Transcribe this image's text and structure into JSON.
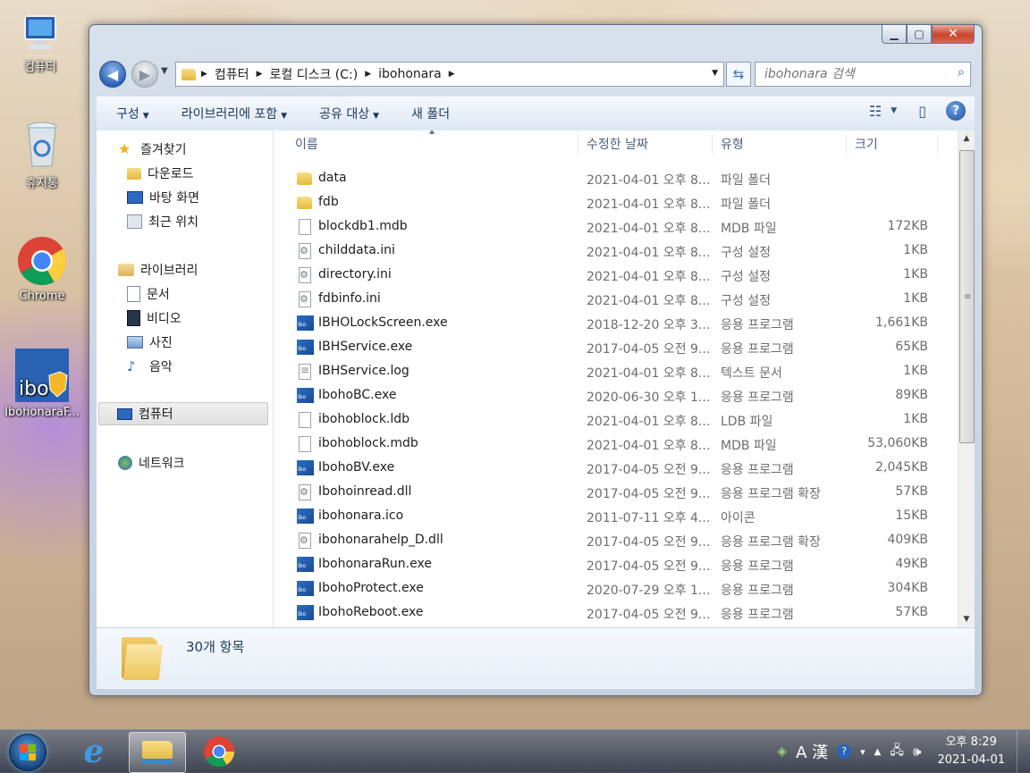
{
  "desktop": {
    "icons": [
      {
        "label": "컴퓨터"
      },
      {
        "label": "휴지통"
      },
      {
        "label": "Chrome"
      },
      {
        "label": "IbohonaraF..."
      }
    ]
  },
  "window": {
    "address": {
      "segments": [
        "컴퓨터",
        "로컬 디스크 (C:)",
        "ibohonara"
      ]
    },
    "search": {
      "placeholder": "ibohonara 검색"
    },
    "commands": [
      "구성",
      "라이브러리에 포함",
      "공유 대상",
      "새 폴더"
    ],
    "nav": {
      "favorites": "즐겨찾기",
      "downloads": "다운로드",
      "desktop": "바탕 화면",
      "recent": "최근 위치",
      "libraries": "라이브러리",
      "documents": "문서",
      "videos": "비디오",
      "pictures": "사진",
      "music": "음악",
      "computer": "컴퓨터",
      "network": "네트워크"
    },
    "columns": {
      "name": "이름",
      "date": "수정한 날짜",
      "type": "유형",
      "size": "크기"
    },
    "files": [
      {
        "name": "data",
        "date": "2021-04-01 오후 8...",
        "type": "파일 폴더",
        "size": "",
        "icon": "folder"
      },
      {
        "name": "fdb",
        "date": "2021-04-01 오후 8...",
        "type": "파일 폴더",
        "size": "",
        "icon": "folder"
      },
      {
        "name": "blockdb1.mdb",
        "date": "2021-04-01 오후 8...",
        "type": "MDB 파일",
        "size": "172KB",
        "icon": "file"
      },
      {
        "name": "childdata.ini",
        "date": "2021-04-01 오후 8...",
        "type": "구성 설정",
        "size": "1KB",
        "icon": "gear"
      },
      {
        "name": "directory.ini",
        "date": "2021-04-01 오후 8...",
        "type": "구성 설정",
        "size": "1KB",
        "icon": "gear"
      },
      {
        "name": "fdbinfo.ini",
        "date": "2021-04-01 오후 8...",
        "type": "구성 설정",
        "size": "1KB",
        "icon": "gear"
      },
      {
        "name": "IBHOLockScreen.exe",
        "date": "2018-12-20 오후 3...",
        "type": "응용 프로그램",
        "size": "1,661KB",
        "icon": "ibo"
      },
      {
        "name": "IBHService.exe",
        "date": "2017-04-05 오전 9...",
        "type": "응용 프로그램",
        "size": "65KB",
        "icon": "ibo"
      },
      {
        "name": "IBHService.log",
        "date": "2021-04-01 오후 8...",
        "type": "텍스트 문서",
        "size": "1KB",
        "icon": "txt"
      },
      {
        "name": "IbohoBC.exe",
        "date": "2020-06-30 오후 1...",
        "type": "응용 프로그램",
        "size": "89KB",
        "icon": "ibo"
      },
      {
        "name": "ibohoblock.ldb",
        "date": "2021-04-01 오후 8...",
        "type": "LDB 파일",
        "size": "1KB",
        "icon": "file"
      },
      {
        "name": "ibohoblock.mdb",
        "date": "2021-04-01 오후 8...",
        "type": "MDB 파일",
        "size": "53,060KB",
        "icon": "file"
      },
      {
        "name": "IbohoBV.exe",
        "date": "2017-04-05 오전 9...",
        "type": "응용 프로그램",
        "size": "2,045KB",
        "icon": "ibo"
      },
      {
        "name": "Ibohoinread.dll",
        "date": "2017-04-05 오전 9...",
        "type": "응용 프로그램 확장",
        "size": "57KB",
        "icon": "dll"
      },
      {
        "name": "ibohonara.ico",
        "date": "2011-07-11 오후 4...",
        "type": "아이콘",
        "size": "15KB",
        "icon": "ibo"
      },
      {
        "name": "ibohonarahelp_D.dll",
        "date": "2017-04-05 오전 9...",
        "type": "응용 프로그램 확장",
        "size": "409KB",
        "icon": "dll"
      },
      {
        "name": "IbohonaraRun.exe",
        "date": "2017-04-05 오전 9...",
        "type": "응용 프로그램",
        "size": "49KB",
        "icon": "ibo"
      },
      {
        "name": "IbohoProtect.exe",
        "date": "2020-07-29 오후 1...",
        "type": "응용 프로그램",
        "size": "304KB",
        "icon": "ibo"
      },
      {
        "name": "IbohoReboot.exe",
        "date": "2017-04-05 오전 9...",
        "type": "응용 프로그램",
        "size": "57KB",
        "icon": "ibo"
      }
    ],
    "details": {
      "count": "30개 항목"
    }
  },
  "taskbar": {
    "ime": "A 漢",
    "clock_time": "오후 8:29",
    "clock_date": "2021-04-01"
  },
  "colors": {
    "accent": "#2c63b8",
    "selection": "#e0e0e0"
  }
}
